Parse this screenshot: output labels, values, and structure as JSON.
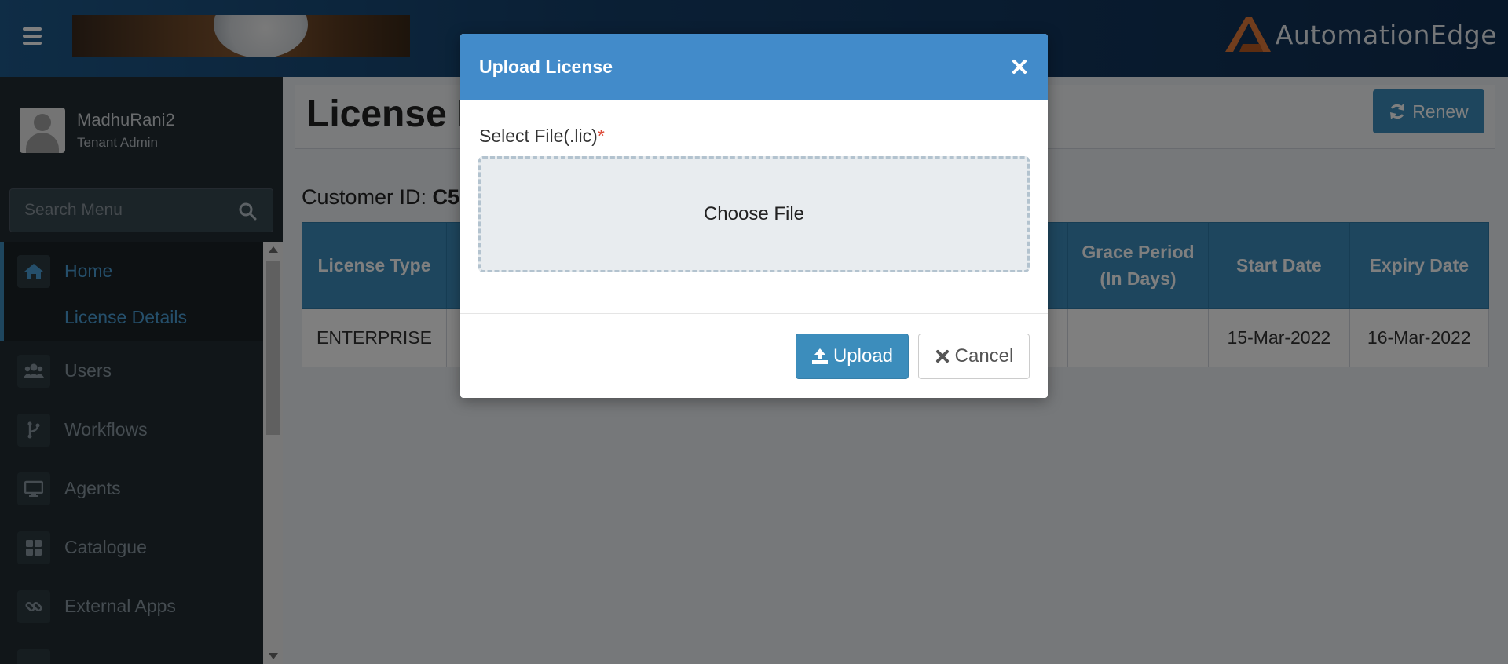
{
  "header": {
    "menu_icon": "hamburger-icon",
    "brand_name": "AutomationEdge",
    "accent_color": "#e27b3a"
  },
  "sidebar": {
    "user": {
      "name": "MadhuRani2",
      "role": "Tenant Admin"
    },
    "search": {
      "placeholder": "Search Menu",
      "icon": "search-icon"
    },
    "menu": [
      {
        "label": "Home",
        "icon": "home-icon",
        "active": true
      },
      {
        "label": "License Details",
        "submenu": true,
        "active": true
      },
      {
        "label": "Users",
        "icon": "users-icon"
      },
      {
        "label": "Workflows",
        "icon": "workflow-icon"
      },
      {
        "label": "Agents",
        "icon": "monitor-icon"
      },
      {
        "label": "Catalogue",
        "icon": "grid-icon"
      },
      {
        "label": "External Apps",
        "icon": "link-icon"
      }
    ]
  },
  "main": {
    "page_title": "License D",
    "renew_label": "Renew",
    "customer_label": "Customer ID: ",
    "customer_id": "C5",
    "table": {
      "columns": [
        "License Type",
        "",
        "",
        "",
        "",
        "Grace Period (In Days)",
        "Start Date",
        "Expiry Date"
      ],
      "rows": [
        [
          "ENTERPRISE",
          "",
          "",
          "",
          "",
          "",
          "15-Mar-2022",
          "16-Mar-2022"
        ]
      ]
    }
  },
  "modal": {
    "title": "Upload License",
    "field_label": "Select File(.lic)",
    "required_mark": "*",
    "dropzone_label": "Choose File",
    "upload_label": "Upload",
    "cancel_label": "Cancel"
  },
  "colors": {
    "primary": "#3c8dbc",
    "modal_header": "#428bca",
    "sidebar_bg": "#222d32",
    "required": "#dd4b39"
  }
}
